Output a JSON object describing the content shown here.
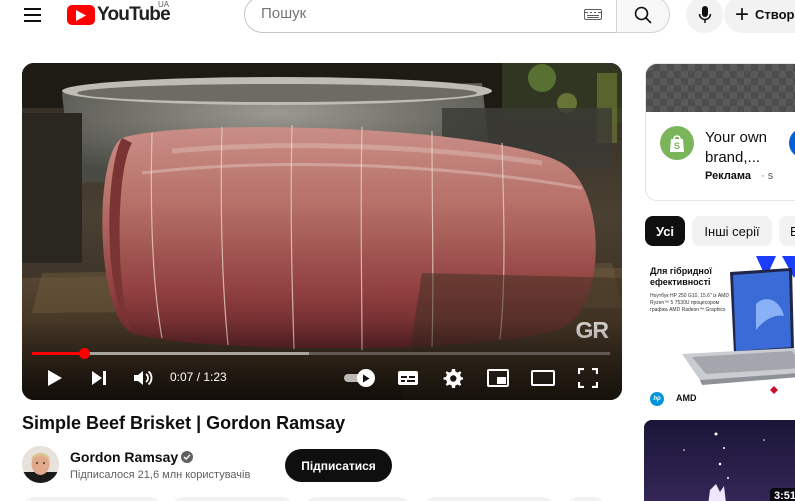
{
  "header": {
    "menu_icon": "hamburger-menu-icon",
    "logo_text": "YouTube",
    "country_code": "UA",
    "search_placeholder": "Пошук",
    "search_icon": "search-icon",
    "keyboard_icon": "keyboard-icon",
    "mic_icon": "microphone-icon",
    "create_label": "Створ"
  },
  "player": {
    "watermark": "GR",
    "time_display": "0:07 / 1:23",
    "progress_played": 0.09,
    "progress_buffered": 0.48,
    "autoplay_on": true,
    "accent_color": "#ff0000",
    "controls": {
      "play": "play-icon",
      "next": "skip-next-icon",
      "volume": "volume-icon",
      "autoplay": "autoplay-toggle",
      "subtitles": "subtitles-icon",
      "settings": "settings-gear-icon",
      "miniplayer": "miniplayer-icon",
      "theater": "theater-mode-icon",
      "fullscreen": "fullscreen-icon"
    }
  },
  "video": {
    "title": "Simple Beef Brisket | Gordon Ramsay",
    "channel_name": "Gordon Ramsay",
    "subscribers": "Підписалося 21,6 млн користувачів",
    "subscribe_label": "Підписатися"
  },
  "sidebar": {
    "ad": {
      "title": "Your own brand,...",
      "label": "Реклама",
      "dot": "· s",
      "icon": "shopify-bag-icon"
    },
    "chips": [
      {
        "label": "Усі",
        "active": true
      },
      {
        "label": "Інші серії",
        "active": false
      },
      {
        "label": "В",
        "active": false
      }
    ],
    "promo": {
      "headline": "Для гібридної ефективності",
      "details": "Ноутбук HP 250 G10, 15.6\" із AMD Ryzen™ 5 7530U процесором графіка AMD Radeon™ Graphics",
      "hp": "hp",
      "amd": "AMD"
    },
    "second_thumb_duration": "3:51"
  }
}
